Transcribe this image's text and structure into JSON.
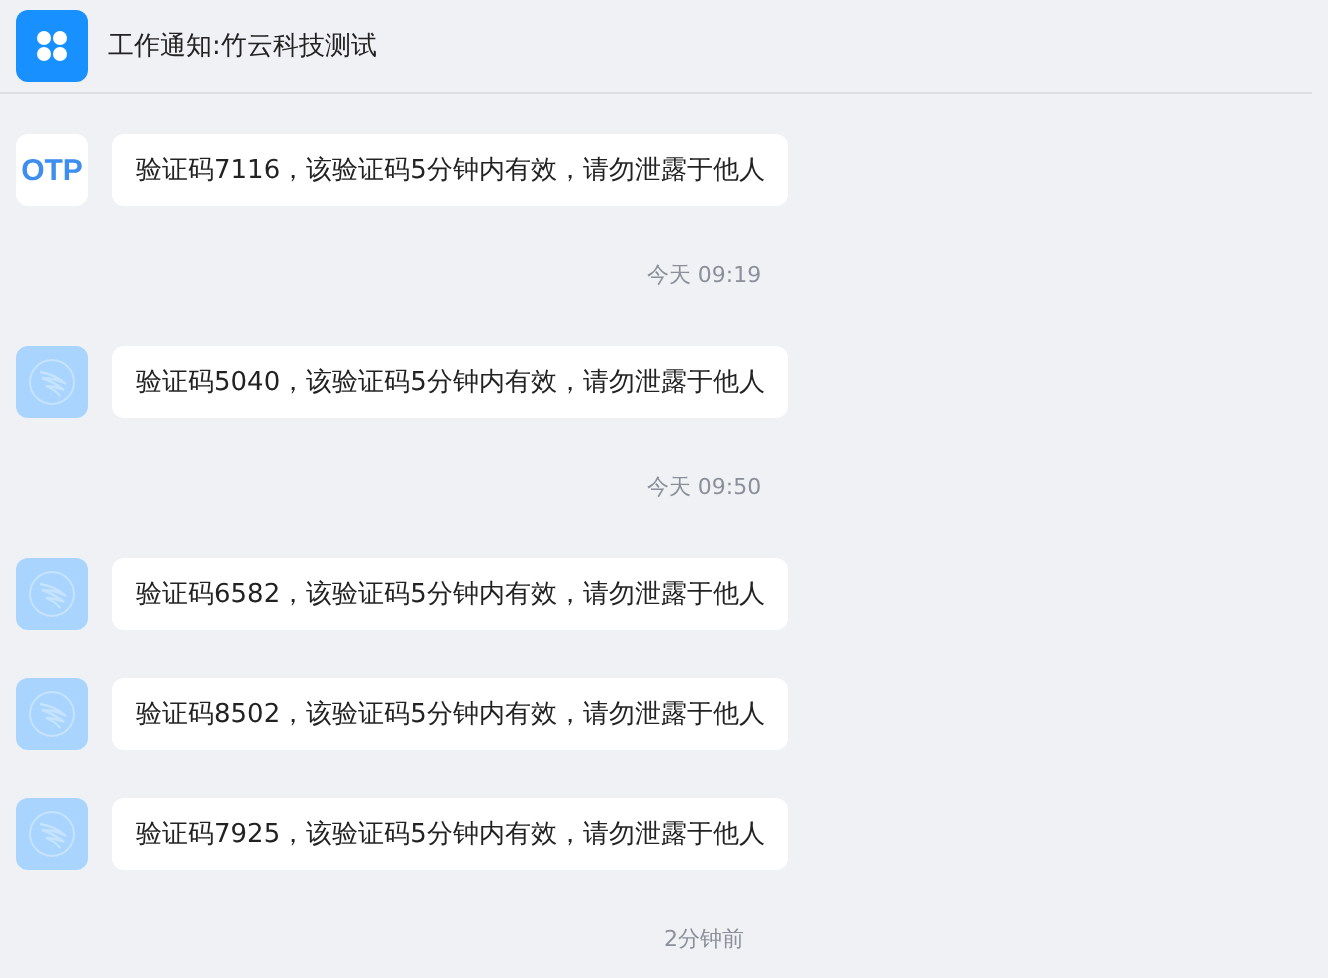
{
  "header": {
    "title": "工作通知:竹云科技测试"
  },
  "messages": [
    {
      "kind": "message",
      "avatar": {
        "kind": "text",
        "text": "OTP"
      },
      "text": "验证码7116，该验证码5分钟内有效，请勿泄露于他人"
    },
    {
      "kind": "time",
      "text": "今天 09:19"
    },
    {
      "kind": "message",
      "avatar": {
        "kind": "logo"
      },
      "text": "验证码5040，该验证码5分钟内有效，请勿泄露于他人"
    },
    {
      "kind": "time",
      "text": "今天 09:50"
    },
    {
      "kind": "message",
      "avatar": {
        "kind": "logo"
      },
      "text": "验证码6582，该验证码5分钟内有效，请勿泄露于他人"
    },
    {
      "kind": "message",
      "avatar": {
        "kind": "logo"
      },
      "text": "验证码8502，该验证码5分钟内有效，请勿泄露于他人"
    },
    {
      "kind": "message",
      "avatar": {
        "kind": "logo"
      },
      "text": "验证码7925，该验证码5分钟内有效，请勿泄露于他人"
    },
    {
      "kind": "time",
      "text": "2分钟前"
    }
  ]
}
